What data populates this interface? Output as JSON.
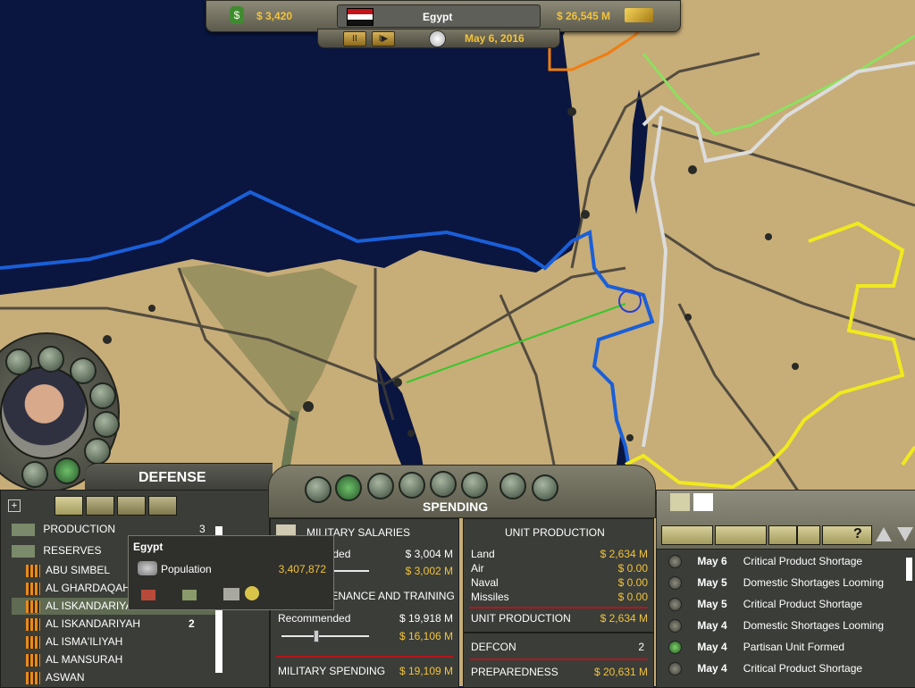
{
  "topbar": {
    "treasury": "$ 3,420",
    "country": "Egypt",
    "gdp": "$ 26,545 M",
    "date": "May 6, 2016",
    "pause_label": "II",
    "play_label": "I▶"
  },
  "advisor": {
    "title": "DEFENSE"
  },
  "tree": {
    "expand_label": "+",
    "production_label": "PRODUCTION",
    "production_count": "3",
    "reserves_label": "RESERVES",
    "items": [
      {
        "name": "ABU SIMBEL",
        "count": ""
      },
      {
        "name": "AL GHARDAQAH",
        "count": ""
      },
      {
        "name": "AL ISKANDARIYAH",
        "count": ""
      },
      {
        "name": "AL ISKANDARIYAH",
        "count": "2"
      },
      {
        "name": "AL ISMA'ILIYAH",
        "count": ""
      },
      {
        "name": "AL MANSURAH",
        "count": ""
      },
      {
        "name": "ASWAN",
        "count": ""
      }
    ]
  },
  "tooltip": {
    "title": "Egypt",
    "label": "Population",
    "value": "3,407,872"
  },
  "spending": {
    "tab_title": "SPENDING",
    "salaries": {
      "title": "MILITARY SALARIES",
      "recommended_label": "Recommended",
      "recommended_value": "$ 3,004 M",
      "current_value": "$ 3,002 M"
    },
    "maintenance": {
      "title": "MAINTENANCE AND TRAINING",
      "recommended_label": "Recommended",
      "recommended_value": "$ 19,918 M",
      "current_value": "$ 16,106 M"
    },
    "military_spending_label": "MILITARY SPENDING",
    "military_spending_value": "$ 19,109 M",
    "unit_production": {
      "title": "UNIT PRODUCTION",
      "rows": [
        {
          "label": "Land",
          "value": "$ 2,634 M"
        },
        {
          "label": "Air",
          "value": "$ 0.00"
        },
        {
          "label": "Naval",
          "value": "$ 0.00"
        },
        {
          "label": "Missiles",
          "value": "$ 0.00"
        }
      ],
      "total_label": "UNIT PRODUCTION",
      "total_value": "$ 2,634 M"
    },
    "defcon_label": "DEFCON",
    "defcon_value": "2",
    "preparedness_label": "PREPAREDNESS",
    "preparedness_value": "$ 20,631 M"
  },
  "news": {
    "items": [
      {
        "date": "May 6",
        "text": "Critical Product Shortage"
      },
      {
        "date": "May 5",
        "text": "Domestic Shortages Looming"
      },
      {
        "date": "May 5",
        "text": "Critical Product Shortage"
      },
      {
        "date": "May 4",
        "text": "Domestic Shortages Looming"
      },
      {
        "date": "May 4",
        "text": "Partisan Unit Formed"
      },
      {
        "date": "May 4",
        "text": "Critical Product Shortage"
      }
    ],
    "help_label": "?"
  },
  "colors": {
    "sea": "#0a1640",
    "land": "#c9b07c",
    "gold_text": "#f2c33a",
    "border_blue": "#1a5fd8",
    "border_yellow": "#f0ea1e",
    "border_green": "#8de060",
    "border_orange": "#f07d10",
    "border_white": "#dcdcdc"
  }
}
